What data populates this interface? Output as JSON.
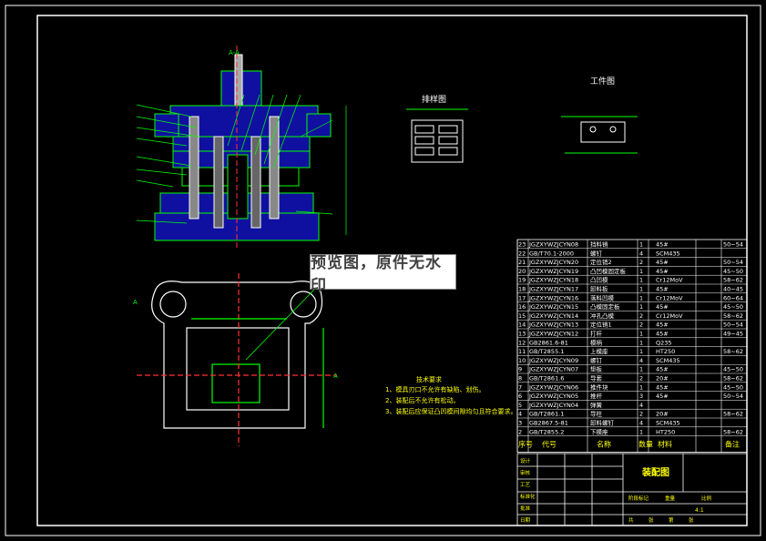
{
  "drawing": {
    "title_block_title": "装配图",
    "scale_label": "4:1",
    "section_label": "A-A",
    "section_a_left": "A",
    "section_a_right": "A"
  },
  "strip_layout": {
    "title": "排样图"
  },
  "part_drawing": {
    "title": "工件图"
  },
  "tech_requirements": {
    "title": "技术要求",
    "items": [
      "1、模具刃口不允许有缺陷、划伤。",
      "2、装配后不允许有松动。",
      "3、装配后应保证凸凹模间隙均匀且符合要求。"
    ]
  },
  "watermark": {
    "text": "预览图，原件无水印"
  },
  "bom": {
    "header": {
      "no": "序号",
      "code": "代号",
      "name": "名称",
      "qty": "数量",
      "material": "材料",
      "note": "备注"
    },
    "rows": [
      {
        "no": "23",
        "code": "JGZXYWZJCYN08",
        "name": "挡料销",
        "qty": "1",
        "material": "45#",
        "note": "50~54"
      },
      {
        "no": "22",
        "code": "GB/T70.1-2000",
        "name": "螺钉",
        "qty": "4",
        "material": "SCM435",
        "note": ""
      },
      {
        "no": "21",
        "code": "JGZXYWZJCYN20",
        "name": "定位销2",
        "qty": "2",
        "material": "45#",
        "note": "50~54"
      },
      {
        "no": "20",
        "code": "JGZXYWZJCYN19",
        "name": "凸凹模固定板",
        "qty": "1",
        "material": "45#",
        "note": "45~50"
      },
      {
        "no": "19",
        "code": "JGZXYWZJCYN18",
        "name": "凸凹模",
        "qty": "1",
        "material": "Cr12MoV",
        "note": "58~62"
      },
      {
        "no": "18",
        "code": "JGZXYWZJCYN17",
        "name": "卸料板",
        "qty": "1",
        "material": "45#",
        "note": "40~45"
      },
      {
        "no": "17",
        "code": "JGZXYWZJCYN16",
        "name": "落料凹模",
        "qty": "1",
        "material": "Cr12MoV",
        "note": "60~64"
      },
      {
        "no": "16",
        "code": "JGZXYWZJCYN15",
        "name": "凸模固定板",
        "qty": "1",
        "material": "45#",
        "note": "45~50"
      },
      {
        "no": "15",
        "code": "JGZXYWZJCYN14",
        "name": "冲孔凸模",
        "qty": "2",
        "material": "Cr12MoV",
        "note": "58~62"
      },
      {
        "no": "14",
        "code": "JGZXYWZJCYN13",
        "name": "定位销1",
        "qty": "2",
        "material": "45#",
        "note": "50~54"
      },
      {
        "no": "13",
        "code": "JGZXYWZJCYN12",
        "name": "打杆",
        "qty": "1",
        "material": "45#",
        "note": "49~45"
      },
      {
        "no": "12",
        "code": "GB2861.6-81",
        "name": "模柄",
        "qty": "1",
        "material": "Q235",
        "note": ""
      },
      {
        "no": "11",
        "code": "GB/T2855.1",
        "name": "上模座",
        "qty": "1",
        "material": "HT250",
        "note": "58~62"
      },
      {
        "no": "10",
        "code": "JGZXYWZJCYN09",
        "name": "螺钉",
        "qty": "4",
        "material": "SCM435",
        "note": ""
      },
      {
        "no": "9",
        "code": "JGZXYWZJCYN07",
        "name": "垫板",
        "qty": "1",
        "material": "45#",
        "note": "45~50"
      },
      {
        "no": "8",
        "code": "GB/T2861.6",
        "name": "导套",
        "qty": "2",
        "material": "20#",
        "note": "58~62"
      },
      {
        "no": "7",
        "code": "JGZXYWZJCYN06",
        "name": "推件块",
        "qty": "1",
        "material": "45#",
        "note": "45~50"
      },
      {
        "no": "6",
        "code": "JGZXYWZJCYN05",
        "name": "推杆",
        "qty": "3",
        "material": "45#",
        "note": "50~54"
      },
      {
        "no": "5",
        "code": "JGZXYWZJCYN04",
        "name": "弹簧",
        "qty": "4",
        "material": "",
        "note": ""
      },
      {
        "no": "4",
        "code": "GB/T2861.1",
        "name": "导柱",
        "qty": "2",
        "material": "20#",
        "note": "58~62"
      },
      {
        "no": "3",
        "code": "GB2867.5-81",
        "name": "卸料螺钉",
        "qty": "4",
        "material": "SCM435",
        "note": ""
      },
      {
        "no": "2",
        "code": "GB/T2855.2",
        "name": "下模座",
        "qty": "1",
        "material": "HT250",
        "note": "58~62"
      }
    ]
  },
  "title_block": {
    "labels": [
      "设计",
      "审核",
      "工艺",
      "标准化",
      "批准",
      "日期"
    ],
    "sub": [
      "阶段标记",
      "重量",
      "比例"
    ],
    "bottom": [
      "共",
      "张",
      "第",
      "张"
    ]
  },
  "colors": {
    "background": "#000000",
    "frame": "#ffffff",
    "outline": "#00ff00",
    "section": "#1010a0",
    "center": "#ff3030",
    "text_yellow": "#ffff00"
  }
}
